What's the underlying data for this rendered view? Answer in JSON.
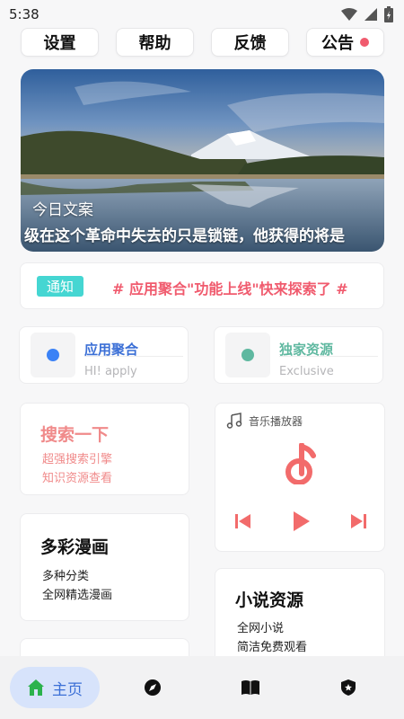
{
  "status": {
    "time": "5:38"
  },
  "top_buttons": {
    "settings": "设置",
    "help": "帮助",
    "feedback": "反馈",
    "announcement": "公告"
  },
  "banner": {
    "title": "今日文案",
    "quote": "级在这个革命中失去的只是锁链，他获得的将是"
  },
  "notice": {
    "badge": "通知",
    "text": "# 应用聚合\"功能上线\"快来探索了 #"
  },
  "features": [
    {
      "title": "应用聚合",
      "subtitle": "HI! apply",
      "color": "#3b82f6"
    },
    {
      "title": "独家资源",
      "subtitle": "Exclusive",
      "color": "#5fb8a0"
    }
  ],
  "search_card": {
    "title": "搜索一下",
    "lines": [
      "超强搜索引擎",
      "知识资源查看"
    ],
    "color": "#f08a8a"
  },
  "music_card": {
    "label": "音乐播放器",
    "accent": "#f26b6b"
  },
  "comic_card": {
    "title": "多彩漫画",
    "lines": [
      "多种分类",
      "全网精选漫画"
    ]
  },
  "novel_card": {
    "title": "小说资源",
    "lines": [
      "全网小说",
      "简洁免费观看"
    ]
  },
  "bottom_nav": {
    "home_label": "主页",
    "items": [
      "home-icon",
      "compass-icon",
      "book-icon",
      "shield-icon"
    ]
  }
}
